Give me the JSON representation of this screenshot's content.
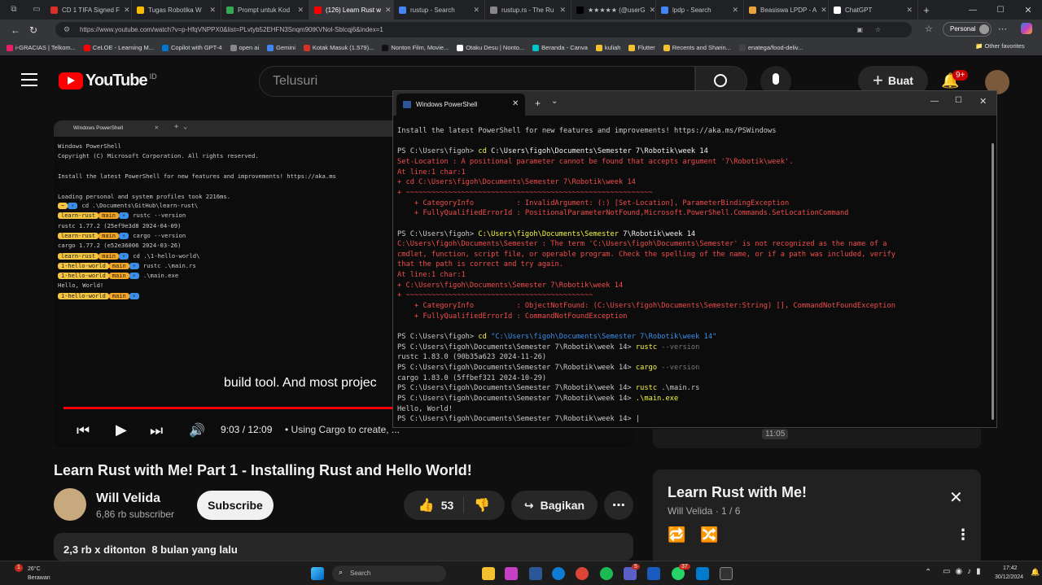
{
  "browser": {
    "tabs": [
      {
        "label": "CD 1 TIFA Signed F",
        "color": "#d93025"
      },
      {
        "label": "Tugas Robotika W",
        "color": "#fbbc04"
      },
      {
        "label": "Prompt untuk Kod",
        "color": "#34a853"
      },
      {
        "label": "(126) Learn Rust w",
        "color": "#ff0000"
      },
      {
        "label": "rustup - Search",
        "color": "#4285f4"
      },
      {
        "label": "rustup.rs - The Ru",
        "color": "#888888"
      },
      {
        "label": "★★★★★ (@userG",
        "color": "#000000"
      },
      {
        "label": "lpdp - Search",
        "color": "#4285f4"
      },
      {
        "label": "Beasiswa LPDP - A",
        "color": "#e8a33d"
      },
      {
        "label": "ChatGPT",
        "color": "#ffffff"
      }
    ],
    "url": "https://www.youtube.com/watch?v=p-HfqVNPPX0&list=PLvtyb52EHFN3Snqm90tKVNol-Sblcqj6&index=1",
    "profile": "Personal",
    "bookmarks": [
      "i-GRACIAS | Telkom...",
      "CeLOE - Learning M...",
      "Copilot with GPT-4",
      "open ai",
      "Gemini",
      "Kotak Masuk (1.579)...",
      "Nonton Film, Movie...",
      "Otaku Desu | Nonto...",
      "Beranda - Canva",
      "kuliah",
      "Flutter",
      "Recents and Sharin...",
      "enatega/food-deliv..."
    ],
    "other_favorites": "Other favorites"
  },
  "youtube": {
    "logo": "YouTube",
    "region": "ID",
    "search_placeholder": "Telusuri",
    "create_label": "Buat",
    "notif_count": "9+",
    "video": {
      "caption": "build tool. And most projec",
      "time": "9:03 / 12:09",
      "chapter": "• Using Cargo to create, ...",
      "progress": 0.746
    },
    "title": "Learn Rust with Me! Part 1 - Installing Rust and Hello World!",
    "channel": "Will Velida",
    "subscribers": "6,86 rb subscriber",
    "subscribe_label": "Subscribe",
    "likes": "53",
    "share_label": "Bagikan",
    "views_date": "2,3 rb x ditonton  8 bulan yang lalu",
    "playlist": {
      "title": "Learn Rust with Me!",
      "meta": "Will Velida · 1 / 6"
    },
    "sidebar_time": "11:05"
  },
  "video_terminal": {
    "title": "Windows PowerShell",
    "lines": [
      "Windows PowerShell",
      "Copyright (C) Microsoft Corporation. All rights reserved.",
      "",
      "Install the latest PowerShell for new features and improvements! https://aka.ms",
      "",
      "Loading personal and system profiles took 2216ms."
    ],
    "prompts": [
      {
        "dir": "~",
        "branch": "",
        "cmd": "cd .\\Documents\\GitHub\\learn-rust\\"
      },
      {
        "dir": "learn-rust",
        "branch": "main",
        "cmd": "rustc --version"
      },
      {
        "out": "rustc 1.77.2 (25ef9e3d8 2024-04-09)"
      },
      {
        "dir": "learn-rust",
        "branch": "main",
        "cmd": "cargo --version"
      },
      {
        "out": "cargo 1.77.2 (e52e36006 2024-03-26)"
      },
      {
        "dir": "learn-rust",
        "branch": "main",
        "cmd": "cd .\\1-hello-world\\"
      },
      {
        "dir": "1-hello-world",
        "branch": "main",
        "cmd": "rustc .\\main.rs"
      },
      {
        "dir": "1-hello-world",
        "branch": "main",
        "cmd": ".\\main.exe"
      },
      {
        "out": "Hello, World!"
      },
      {
        "dir": "1-hello-world",
        "branch": "main",
        "cmd": ""
      }
    ]
  },
  "powershell": {
    "title": "Windows PowerShell",
    "lines": [
      {
        "parts": [
          {
            "t": "Install the latest PowerShell for new features and improvements! https://aka.ms/PSWindows",
            "c": ""
          }
        ]
      },
      {
        "parts": []
      },
      {
        "parts": [
          {
            "t": "PS C:\\Users\\figoh> ",
            "c": ""
          },
          {
            "t": "cd ",
            "c": "y"
          },
          {
            "t": "C:\\Users\\figoh\\Documents\\Semester 7\\Robotik\\week 14",
            "c": "w"
          }
        ]
      },
      {
        "parts": [
          {
            "t": "Set-Location : A positional parameter cannot be found that accepts argument '7\\Robotik\\week'.",
            "c": "r"
          }
        ]
      },
      {
        "parts": [
          {
            "t": "At line:1 char:1",
            "c": "r"
          }
        ]
      },
      {
        "parts": [
          {
            "t": "+ cd C:\\Users\\figoh\\Documents\\Semester 7\\Robotik\\week 14",
            "c": "r"
          }
        ]
      },
      {
        "parts": [
          {
            "t": "+ ~~~~~~~~~~~~~~~~~~~~~~~~~~~~~~~~~~~~~~~~~~~~~~~~~~~~~~~~~~",
            "c": "r"
          }
        ]
      },
      {
        "parts": [
          {
            "t": "    + CategoryInfo          : InvalidArgument: (:) [Set-Location], ParameterBindingException",
            "c": "r"
          }
        ]
      },
      {
        "parts": [
          {
            "t": "    + FullyQualifiedErrorId : PositionalParameterNotFound,Microsoft.PowerShell.Commands.SetLocationCommand",
            "c": "r"
          }
        ]
      },
      {
        "parts": []
      },
      {
        "parts": [
          {
            "t": "PS C:\\Users\\figoh> ",
            "c": ""
          },
          {
            "t": "C:\\Users\\figoh\\Documents\\Semester ",
            "c": "y"
          },
          {
            "t": "7\\Robotik\\week 14",
            "c": "w"
          }
        ]
      },
      {
        "parts": [
          {
            "t": "C:\\Users\\figoh\\Documents\\Semester : The term 'C:\\Users\\figoh\\Documents\\Semester' is not recognized as the name of a",
            "c": "r"
          }
        ]
      },
      {
        "parts": [
          {
            "t": "cmdlet, function, script file, or operable program. Check the spelling of the name, or if a path was included, verify",
            "c": "r"
          }
        ]
      },
      {
        "parts": [
          {
            "t": "that the path is correct and try again.",
            "c": "r"
          }
        ]
      },
      {
        "parts": [
          {
            "t": "At line:1 char:1",
            "c": "r"
          }
        ]
      },
      {
        "parts": [
          {
            "t": "+ C:\\Users\\figoh\\Documents\\Semester 7\\Robotik\\week 14",
            "c": "r"
          }
        ]
      },
      {
        "parts": [
          {
            "t": "+ ~~~~~~~~~~~~~~~~~~~~~~~~~~~~~~~~~~~~~~~~~~~~",
            "c": "r"
          }
        ]
      },
      {
        "parts": [
          {
            "t": "    + CategoryInfo          : ObjectNotFound: (C:\\Users\\figoh\\Documents\\Semester:String) [], CommandNotFoundException",
            "c": "r"
          }
        ]
      },
      {
        "parts": [
          {
            "t": "    + FullyQualifiedErrorId : CommandNotFoundException",
            "c": "r"
          }
        ]
      },
      {
        "parts": []
      },
      {
        "parts": [
          {
            "t": "PS C:\\Users\\figoh> ",
            "c": ""
          },
          {
            "t": "cd ",
            "c": "y"
          },
          {
            "t": "\"C:\\Users\\figoh\\Documents\\Semester 7\\Robotik\\week 14\"",
            "c": "bl"
          }
        ]
      },
      {
        "parts": [
          {
            "t": "PS C:\\Users\\figoh\\Documents\\Semester 7\\Robotik\\week 14> ",
            "c": ""
          },
          {
            "t": "rustc ",
            "c": "y"
          },
          {
            "t": "--version",
            "c": "gy"
          }
        ]
      },
      {
        "parts": [
          {
            "t": "rustc 1.83.0 (90b35a623 2024-11-26)",
            "c": ""
          }
        ]
      },
      {
        "parts": [
          {
            "t": "PS C:\\Users\\figoh\\Documents\\Semester 7\\Robotik\\week 14> ",
            "c": ""
          },
          {
            "t": "cargo ",
            "c": "y"
          },
          {
            "t": "--version",
            "c": "gy"
          }
        ]
      },
      {
        "parts": [
          {
            "t": "cargo 1.83.0 (5ffbef321 2024-10-29)",
            "c": ""
          }
        ]
      },
      {
        "parts": [
          {
            "t": "PS C:\\Users\\figoh\\Documents\\Semester 7\\Robotik\\week 14> ",
            "c": ""
          },
          {
            "t": "rustc ",
            "c": "y"
          },
          {
            "t": ".\\main.rs",
            "c": ""
          }
        ]
      },
      {
        "parts": [
          {
            "t": "PS C:\\Users\\figoh\\Documents\\Semester 7\\Robotik\\week 14> ",
            "c": ""
          },
          {
            "t": ".\\main.exe",
            "c": "y"
          }
        ]
      },
      {
        "parts": [
          {
            "t": "Hello, World!",
            "c": ""
          }
        ]
      },
      {
        "parts": [
          {
            "t": "PS C:\\Users\\figoh\\Documents\\Semester 7\\Robotik\\week 14> |",
            "c": ""
          }
        ]
      }
    ]
  },
  "taskbar": {
    "weather_temp": "26°C",
    "weather_desc": "Berawan",
    "weather_badge": "1",
    "search_placeholder": "Search",
    "badges": {
      "teams": "5",
      "whatsapp": "37"
    },
    "time": "17:42",
    "date": "30/12/2024"
  }
}
